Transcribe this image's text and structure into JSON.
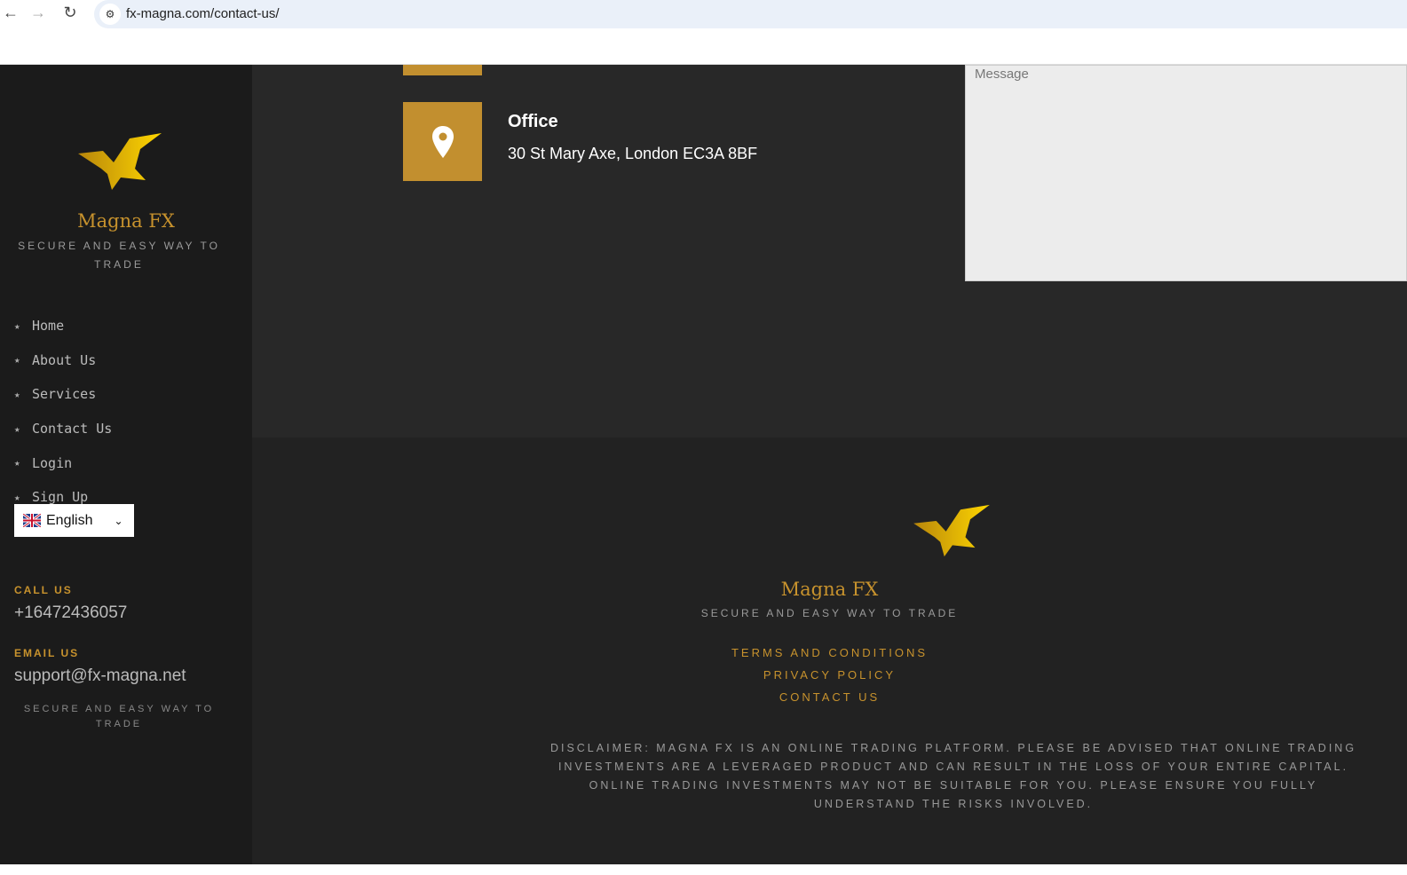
{
  "browser": {
    "url": "fx-magna.com/contact-us/"
  },
  "brand": {
    "name": "Magna FX",
    "tagline": "SECURE AND EASY WAY TO TRADE"
  },
  "sidebar": {
    "menu": [
      {
        "label": "Home"
      },
      {
        "label": "About Us"
      },
      {
        "label": "Services"
      },
      {
        "label": "Contact Us"
      },
      {
        "label": "Login"
      },
      {
        "label": "Sign Up"
      }
    ],
    "language": "English",
    "call_label": "CALL US",
    "phone": "+16472436057",
    "email_label": "EMAIL US",
    "email": "support@fx-magna.net",
    "tagline": "SECURE AND EASY WAY TO TRADE"
  },
  "main": {
    "office_title": "Office",
    "office_address": "30 St Mary Axe, London EC3A 8BF",
    "message_placeholder": "Message"
  },
  "footer": {
    "links": [
      {
        "label": "TERMS AND CONDITIONS"
      },
      {
        "label": "PRIVACY POLICY"
      },
      {
        "label": "CONTACT US"
      }
    ],
    "disclaimer": "DISCLAIMER: MAGNA FX IS AN ONLINE TRADING PLATFORM. PLEASE BE ADVISED THAT ONLINE TRADING INVESTMENTS ARE A LEVERAGED PRODUCT AND CAN RESULT IN THE LOSS OF YOUR ENTIRE CAPITAL. ONLINE TRADING INVESTMENTS MAY NOT BE SUITABLE FOR YOU. PLEASE ENSURE YOU FULLY UNDERSTAND THE RISKS INVOLVED."
  }
}
